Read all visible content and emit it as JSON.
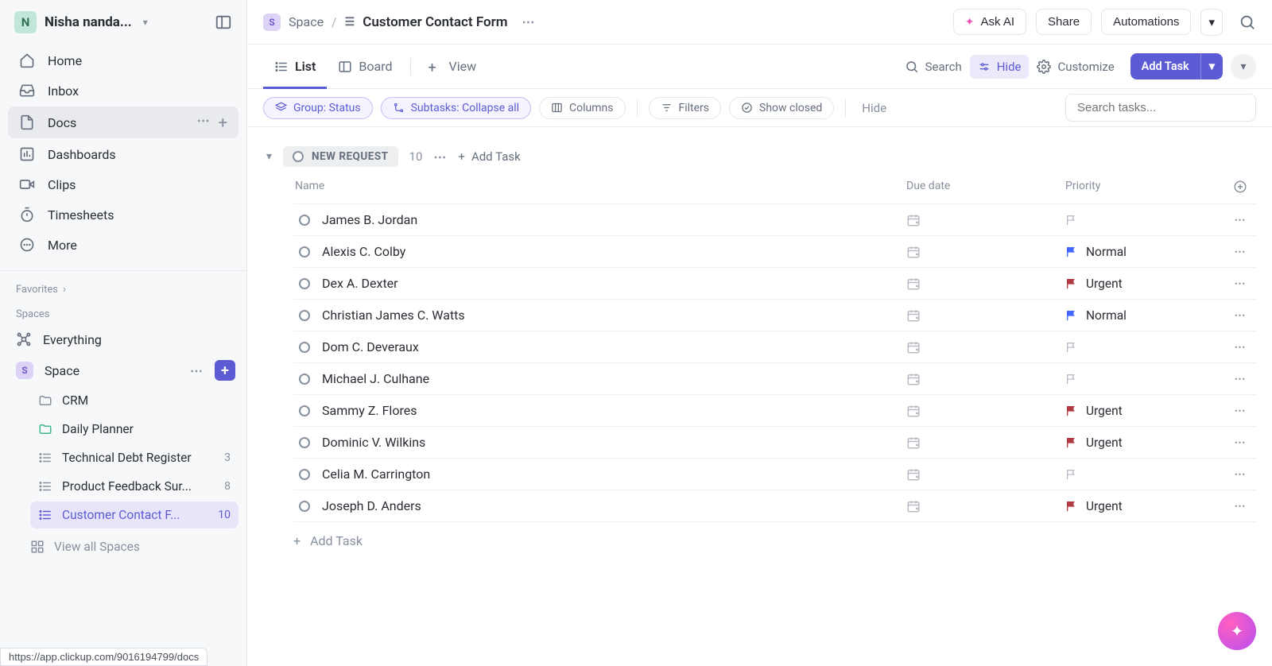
{
  "workspace": {
    "initial": "N",
    "name": "Nisha nanda..."
  },
  "sidebar": {
    "nav": [
      {
        "label": "Home"
      },
      {
        "label": "Inbox"
      },
      {
        "label": "Docs"
      },
      {
        "label": "Dashboards"
      },
      {
        "label": "Clips"
      },
      {
        "label": "Timesheets"
      },
      {
        "label": "More"
      }
    ],
    "favorites_label": "Favorites",
    "spaces_label": "Spaces",
    "everything_label": "Everything",
    "space_name": "Space",
    "space_initial": "S",
    "tree": [
      {
        "label": "CRM",
        "count": ""
      },
      {
        "label": "Daily Planner",
        "count": ""
      },
      {
        "label": "Technical Debt Register",
        "count": "3"
      },
      {
        "label": "Product Feedback Sur...",
        "count": "8"
      },
      {
        "label": "Customer Contact F...",
        "count": "10"
      }
    ],
    "view_all_label": "View all Spaces"
  },
  "breadcrumb": {
    "space": "Space",
    "space_initial": "S",
    "title": "Customer Contact Form"
  },
  "topbar": {
    "ask_ai": "Ask AI",
    "share": "Share",
    "automations": "Automations"
  },
  "viewtabs": {
    "list": "List",
    "board": "Board",
    "add_view": "View"
  },
  "viewactions": {
    "search": "Search",
    "hide": "Hide",
    "customize": "Customize",
    "add_task": "Add Task"
  },
  "filterbar": {
    "group": "Group: Status",
    "subtasks": "Subtasks: Collapse all",
    "columns": "Columns",
    "filters": "Filters",
    "show_closed": "Show closed",
    "hide": "Hide",
    "search_placeholder": "Search tasks..."
  },
  "group": {
    "name": "NEW REQUEST",
    "count": "10",
    "add_task": "Add Task"
  },
  "columns": {
    "name": "Name",
    "due": "Due date",
    "priority": "Priority"
  },
  "priority_labels": {
    "normal": "Normal",
    "urgent": "Urgent"
  },
  "tasks": [
    {
      "name": "James B. Jordan",
      "priority": ""
    },
    {
      "name": "Alexis C. Colby",
      "priority": "normal"
    },
    {
      "name": "Dex A. Dexter",
      "priority": "urgent"
    },
    {
      "name": "Christian James C. Watts",
      "priority": "normal"
    },
    {
      "name": "Dom C. Deveraux",
      "priority": ""
    },
    {
      "name": "Michael J. Culhane",
      "priority": ""
    },
    {
      "name": "Sammy Z. Flores",
      "priority": "urgent"
    },
    {
      "name": "Dominic V. Wilkins",
      "priority": "urgent"
    },
    {
      "name": "Celia M. Carrington",
      "priority": ""
    },
    {
      "name": "Joseph D. Anders",
      "priority": "urgent"
    }
  ],
  "bottom_add_task": "Add Task",
  "status_url": "https://app.clickup.com/9016194799/docs"
}
